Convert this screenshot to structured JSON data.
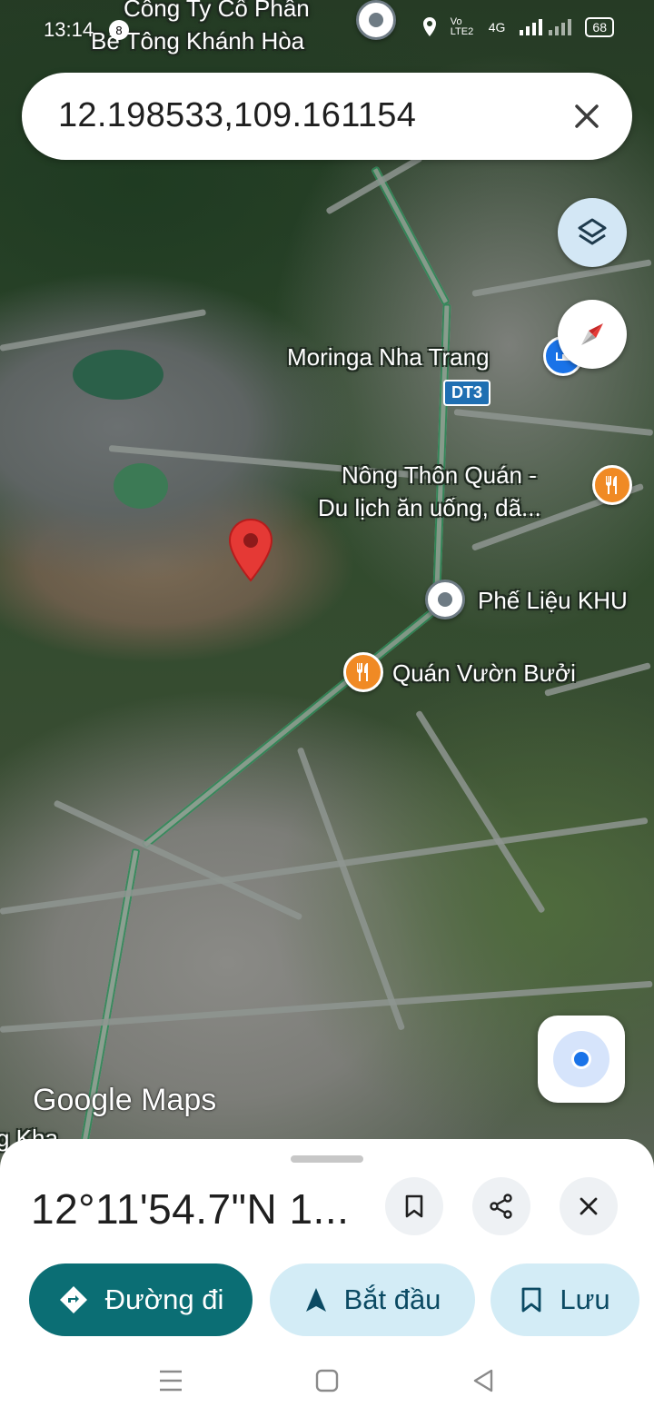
{
  "status_bar": {
    "time": "13:14",
    "notification_count": "8",
    "network": "4G",
    "volte": "Vo LTE2",
    "battery": "68"
  },
  "search": {
    "value": "12.198533,109.161154"
  },
  "map": {
    "labels": {
      "company_line1": "Công Ty Cổ Phần",
      "company_line2": "Bê Tông Khánh Hòa",
      "moringa": "Moringa Nha Trang",
      "route_shield": "DT3",
      "nong_thon_line1": "Nông Thôn Quán -",
      "nong_thon_line2": "Du lịch ăn uống, dã...",
      "phe_lieu": "Phế Liệu KHU",
      "quan_vuon_buoi": "Quán Vườn Bưởi",
      "kha_partial": "g Kha"
    },
    "attribution": "Google Maps"
  },
  "place_sheet": {
    "title": "12°11'54.7\"N 1...",
    "actions": {
      "directions": "Đường đi",
      "start": "Bắt đầu",
      "save": "Lưu"
    }
  },
  "colors": {
    "primary_button": "#0b6e74",
    "secondary_button": "#d3ecf6",
    "pin_red": "#e53935",
    "food_poi": "#f08a24",
    "location_blue": "#1a73e8"
  },
  "icons": [
    "layers-icon",
    "compass-icon",
    "my-location-icon",
    "bookmark-icon",
    "share-icon",
    "close-icon",
    "directions-icon",
    "navigation-arrow-icon"
  ]
}
